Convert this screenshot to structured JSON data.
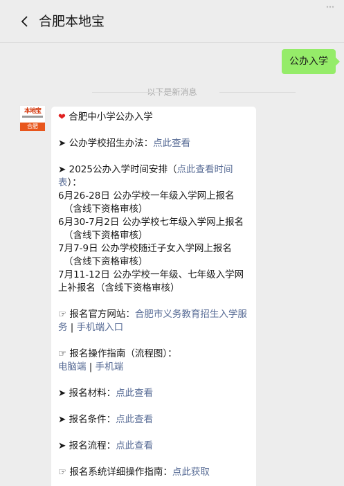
{
  "header": {
    "title": "合肥本地宝",
    "back_icon": "chevron-left-icon",
    "more_icon": "more-dots-icon"
  },
  "user_message": "公办入学",
  "divider_text": "以下是新消息",
  "avatar": {
    "logo_text": "本地宝",
    "badge_text": "合肥"
  },
  "reply": {
    "title": "合肥中小学公办入学",
    "item1_prefix": "➤ 公办学校招生办法：",
    "item1_link": "点此查看",
    "item2_prefix": "➤ 2025公办入学时间安排（",
    "item2_link": "点此查看时间表",
    "item2_suffix": "）：",
    "schedule": [
      {
        "main": "6月26-28日 公办学校一年级入学网上报名",
        "note": "（含线下资格审核）"
      },
      {
        "main": "6月30-7月2日 公办学校七年级入学网上报名",
        "note": "（含线下资格审核）"
      },
      {
        "main": "7月7-9日 公办学校随迁子女入学网上报名",
        "note": "（含线下资格审核）"
      },
      {
        "main": "7月11-12日 公办学校一年级、七年级入学网上补报名（含线下资格审核）",
        "note": ""
      }
    ],
    "site_prefix": "☞ 报名官方网站：",
    "site_link1": "合肥市义务教育招生入学服务",
    "site_sep": " | ",
    "site_link2": "手机端入口",
    "guide_prefix": "☞ 报名操作指南（流程图）：",
    "guide_link1": "电脑端",
    "guide_sep": " | ",
    "guide_link2": "手机端",
    "materials_prefix": "➤ 报名材料：",
    "materials_link": "点此查看",
    "conditions_prefix": "➤ 报名条件：",
    "conditions_link": "点此查看",
    "process_prefix": "➤ 报名流程：",
    "process_link": "点此查看",
    "system_prefix": "☞ 报名系统详细操作指南：",
    "system_link": "点此获取"
  },
  "colors": {
    "background": "#ededed",
    "user_bubble": "#95ec69",
    "link": "#576b95",
    "heart": "#e02020"
  }
}
